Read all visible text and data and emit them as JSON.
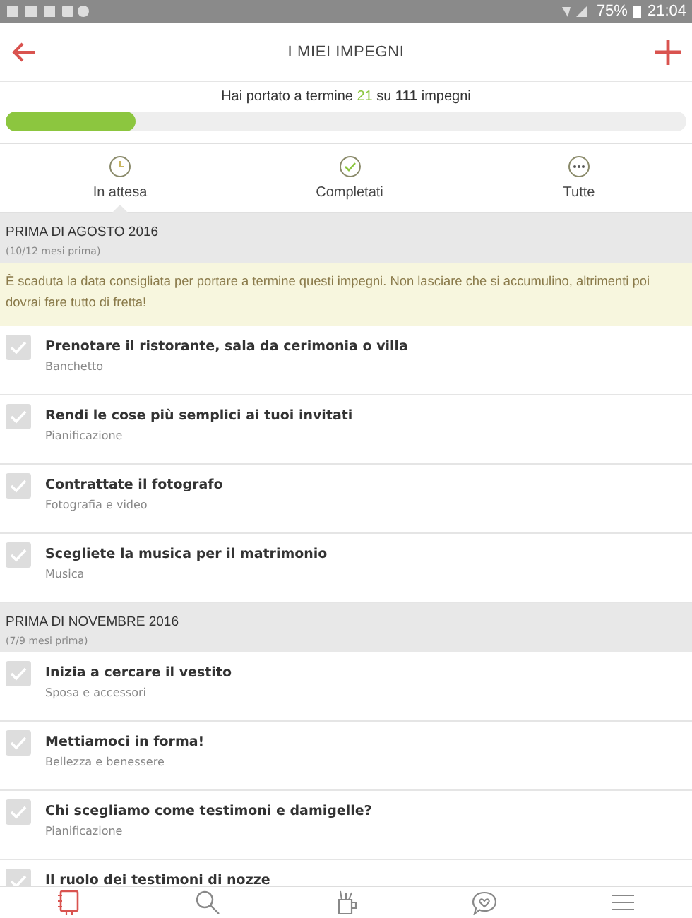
{
  "status_bar": {
    "battery": "75%",
    "time": "21:04"
  },
  "header": {
    "title": "I MIEI IMPEGNI"
  },
  "progress": {
    "before": "Hai portato a termine",
    "done": "21",
    "middle": "su",
    "total": "111",
    "after": "impegni",
    "level": 0.19
  },
  "tabs": [
    {
      "label": "In attesa",
      "selected": true
    },
    {
      "label": "Completati",
      "selected": false
    },
    {
      "label": "Tutte",
      "selected": false
    }
  ],
  "sections": [
    {
      "title": "PRIMA DI AGOSTO 2016",
      "subtitle": "(10/12 mesi prima)",
      "notice": "È scaduta la data consigliata per portare a termine questi impegni. Non lasciare che si accumulino, altrimenti poi dovrai fare tutto di fretta!",
      "tasks": [
        {
          "title": "Prenotare il ristorante, sala da cerimonia o villa",
          "category": "Banchetto",
          "checked": false
        },
        {
          "title": "Rendi le cose più semplici ai tuoi invitati",
          "category": "Pianificazione",
          "checked": false
        },
        {
          "title": "Contrattate il fotografo",
          "category": "Fotografia e video",
          "checked": false
        },
        {
          "title": "Scegliete la musica per il matrimonio",
          "category": "Musica",
          "checked": false
        }
      ]
    },
    {
      "title": "PRIMA DI NOVEMBRE 2016",
      "subtitle": "(7/9 mesi prima)",
      "tasks": [
        {
          "title": "Inizia a cercare il vestito",
          "category": "Sposa e accessori",
          "checked": false
        },
        {
          "title": "Mettiamoci in forma!",
          "category": "Bellezza e benessere",
          "checked": false
        },
        {
          "title": "Chi scegliamo come testimoni e damigelle?",
          "category": "Pianificazione",
          "checked": false
        },
        {
          "title": "Il ruolo dei testimoni di nozze",
          "checked": false
        }
      ]
    }
  ],
  "nav": [
    {
      "selected": true
    },
    {
      "selected": false
    },
    {
      "selected": false
    },
    {
      "selected": false
    },
    {
      "selected": false
    }
  ]
}
